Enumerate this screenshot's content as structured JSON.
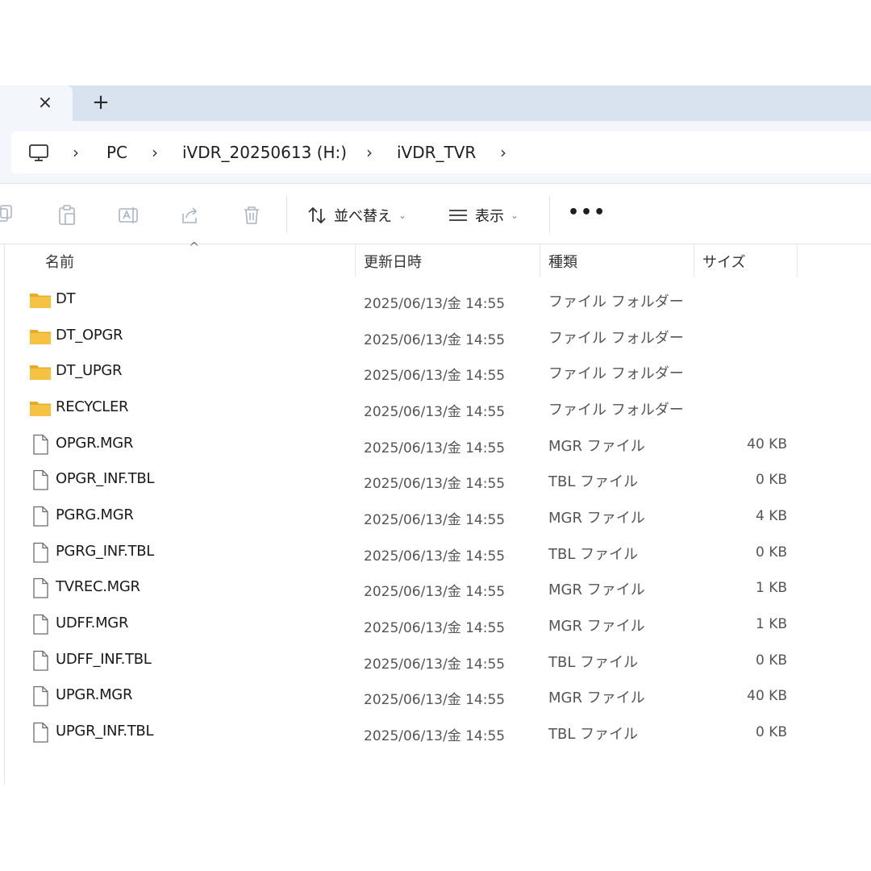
{
  "tabs": {
    "close_icon": "close-icon",
    "new_tab_icon": "plus-icon"
  },
  "breadcrumb": {
    "root_icon": "computer-icon",
    "items": [
      "PC",
      "iVDR_20250613 (H:)",
      "iVDR_TVR"
    ]
  },
  "commandbar": {
    "sort_label": "並べ替え",
    "view_label": "表示",
    "more_label": "•••"
  },
  "columns": {
    "name": "名前",
    "modified": "更新日時",
    "type": "種類",
    "size": "サイズ"
  },
  "files": [
    {
      "name": "DT",
      "modified": "2025/06/13/金 14:55",
      "type": "ファイル フォルダー",
      "size": "",
      "kind": "folder"
    },
    {
      "name": "DT_OPGR",
      "modified": "2025/06/13/金 14:55",
      "type": "ファイル フォルダー",
      "size": "",
      "kind": "folder"
    },
    {
      "name": "DT_UPGR",
      "modified": "2025/06/13/金 14:55",
      "type": "ファイル フォルダー",
      "size": "",
      "kind": "folder"
    },
    {
      "name": "RECYCLER",
      "modified": "2025/06/13/金 14:55",
      "type": "ファイル フォルダー",
      "size": "",
      "kind": "folder"
    },
    {
      "name": "OPGR.MGR",
      "modified": "2025/06/13/金 14:55",
      "type": "MGR ファイル",
      "size": "40 KB",
      "kind": "file"
    },
    {
      "name": "OPGR_INF.TBL",
      "modified": "2025/06/13/金 14:55",
      "type": "TBL ファイル",
      "size": "0 KB",
      "kind": "file"
    },
    {
      "name": "PGRG.MGR",
      "modified": "2025/06/13/金 14:55",
      "type": "MGR ファイル",
      "size": "4 KB",
      "kind": "file"
    },
    {
      "name": "PGRG_INF.TBL",
      "modified": "2025/06/13/金 14:55",
      "type": "TBL ファイル",
      "size": "0 KB",
      "kind": "file"
    },
    {
      "name": "TVREC.MGR",
      "modified": "2025/06/13/金 14:55",
      "type": "MGR ファイル",
      "size": "1 KB",
      "kind": "file"
    },
    {
      "name": "UDFF.MGR",
      "modified": "2025/06/13/金 14:55",
      "type": "MGR ファイル",
      "size": "1 KB",
      "kind": "file"
    },
    {
      "name": "UDFF_INF.TBL",
      "modified": "2025/06/13/金 14:55",
      "type": "TBL ファイル",
      "size": "0 KB",
      "kind": "file"
    },
    {
      "name": "UPGR.MGR",
      "modified": "2025/06/13/金 14:55",
      "type": "MGR ファイル",
      "size": "40 KB",
      "kind": "file"
    },
    {
      "name": "UPGR_INF.TBL",
      "modified": "2025/06/13/金 14:55",
      "type": "TBL ファイル",
      "size": "0 KB",
      "kind": "file"
    }
  ],
  "colors": {
    "tabstrip": "#d8e3ef",
    "folder": "#f5c242",
    "folder_tab": "#e8ac22"
  }
}
